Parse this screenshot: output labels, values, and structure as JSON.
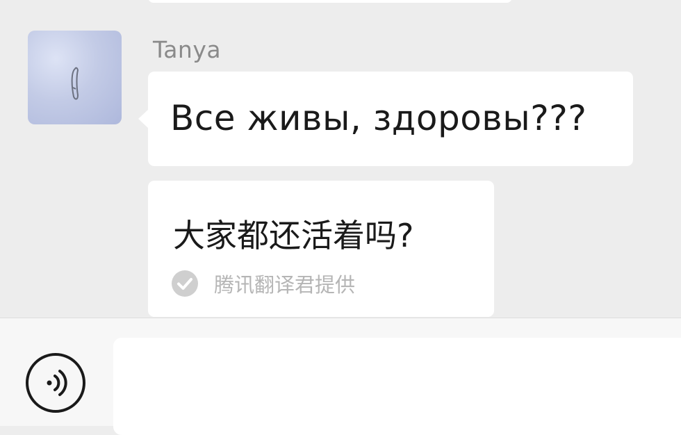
{
  "chat": {
    "sender_name": "Tanya",
    "avatar_icon": "snow-footprint-avatar",
    "messages": [
      {
        "text": "Все живы, здоровы???"
      },
      {
        "text": "大家都还活着吗?",
        "credit_icon": "check-circle-icon",
        "credit": "腾讯翻译君提供"
      }
    ]
  },
  "input_bar": {
    "voice_icon": "voice-icon",
    "input_value": ""
  },
  "colors": {
    "background": "#ededed",
    "bubble": "#ffffff",
    "sender_text": "#8a8a8a",
    "credit_text": "#b5b5b5"
  }
}
